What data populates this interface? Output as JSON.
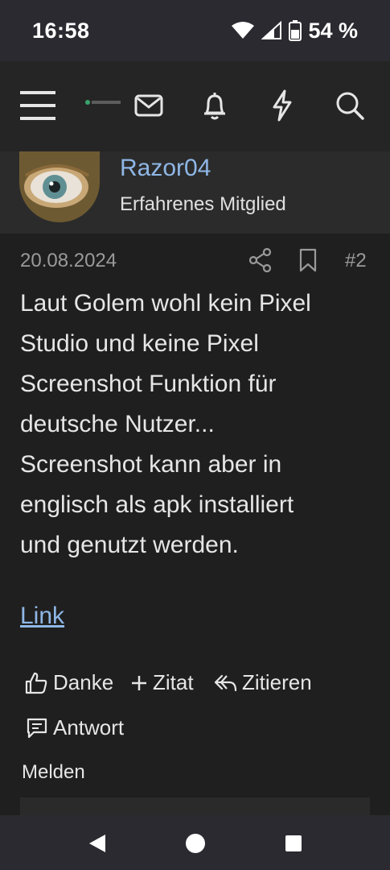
{
  "status_bar": {
    "time": "16:58",
    "battery": "54 %",
    "icons": [
      "wifi-icon",
      "signal-icon",
      "battery-icon"
    ]
  },
  "top_nav": {
    "icons": [
      "menu-icon",
      "site-logo",
      "mail-icon",
      "bell-icon",
      "bolt-icon",
      "search-icon"
    ]
  },
  "post": {
    "author": "Razor04",
    "author_title": "Erfahrenes Mitglied",
    "date": "20.08.2024",
    "number": "#2",
    "body_lines": [
      "Laut Golem wohl kein Pixel",
      "Studio und keine Pixel",
      "Screenshot Funktion für",
      "deutsche Nutzer...",
      "Screenshot kann aber in",
      "englisch als apk installiert",
      "und genutzt werden."
    ],
    "link_text": "Link"
  },
  "actions": {
    "like": "Danke",
    "quote_plus": "Zitat",
    "quote": "Zitieren",
    "reply": "Antwort",
    "report": "Melden"
  },
  "colors": {
    "background": "#1f1f1f",
    "link": "#8fb7e6",
    "muted": "#9a9a9a"
  }
}
